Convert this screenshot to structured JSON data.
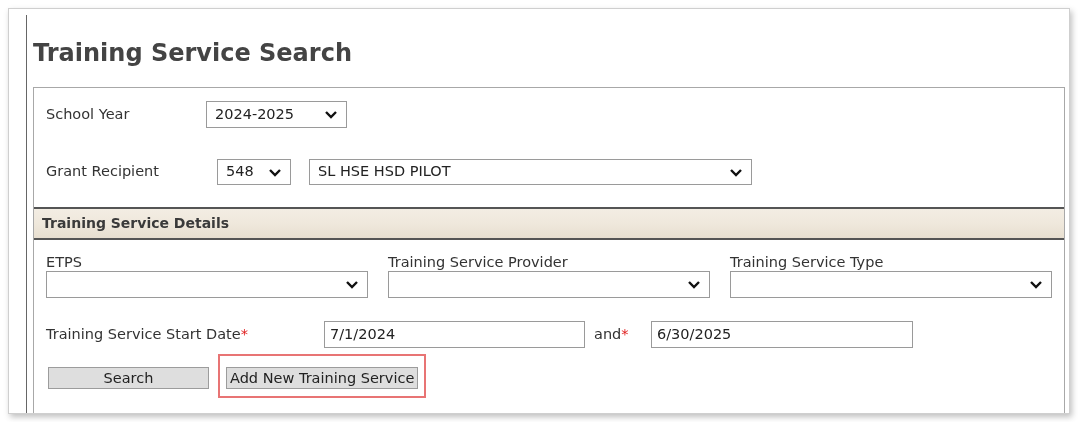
{
  "page_title": "Training Service Search",
  "filters": {
    "school_year": {
      "label": "School Year",
      "value": "2024-2025"
    },
    "grant_recipient": {
      "label": "Grant Recipient",
      "code": "548",
      "name": "SL HSE HSD PILOT"
    }
  },
  "details": {
    "title": "Training Service Details",
    "dropdowns": [
      {
        "label": "ETPS"
      },
      {
        "label": "Training Service Provider"
      },
      {
        "label": "Training Service Type"
      }
    ],
    "start_date": {
      "label": "Training Service Start Date",
      "required_mark": "*",
      "from": "7/1/2024",
      "joiner": "and",
      "joiner_mark": "*",
      "to": "6/30/2025"
    },
    "buttons": [
      {
        "label": "Search",
        "highlighted": false
      },
      {
        "label": "Add New Training Service",
        "highlighted": true
      }
    ]
  }
}
